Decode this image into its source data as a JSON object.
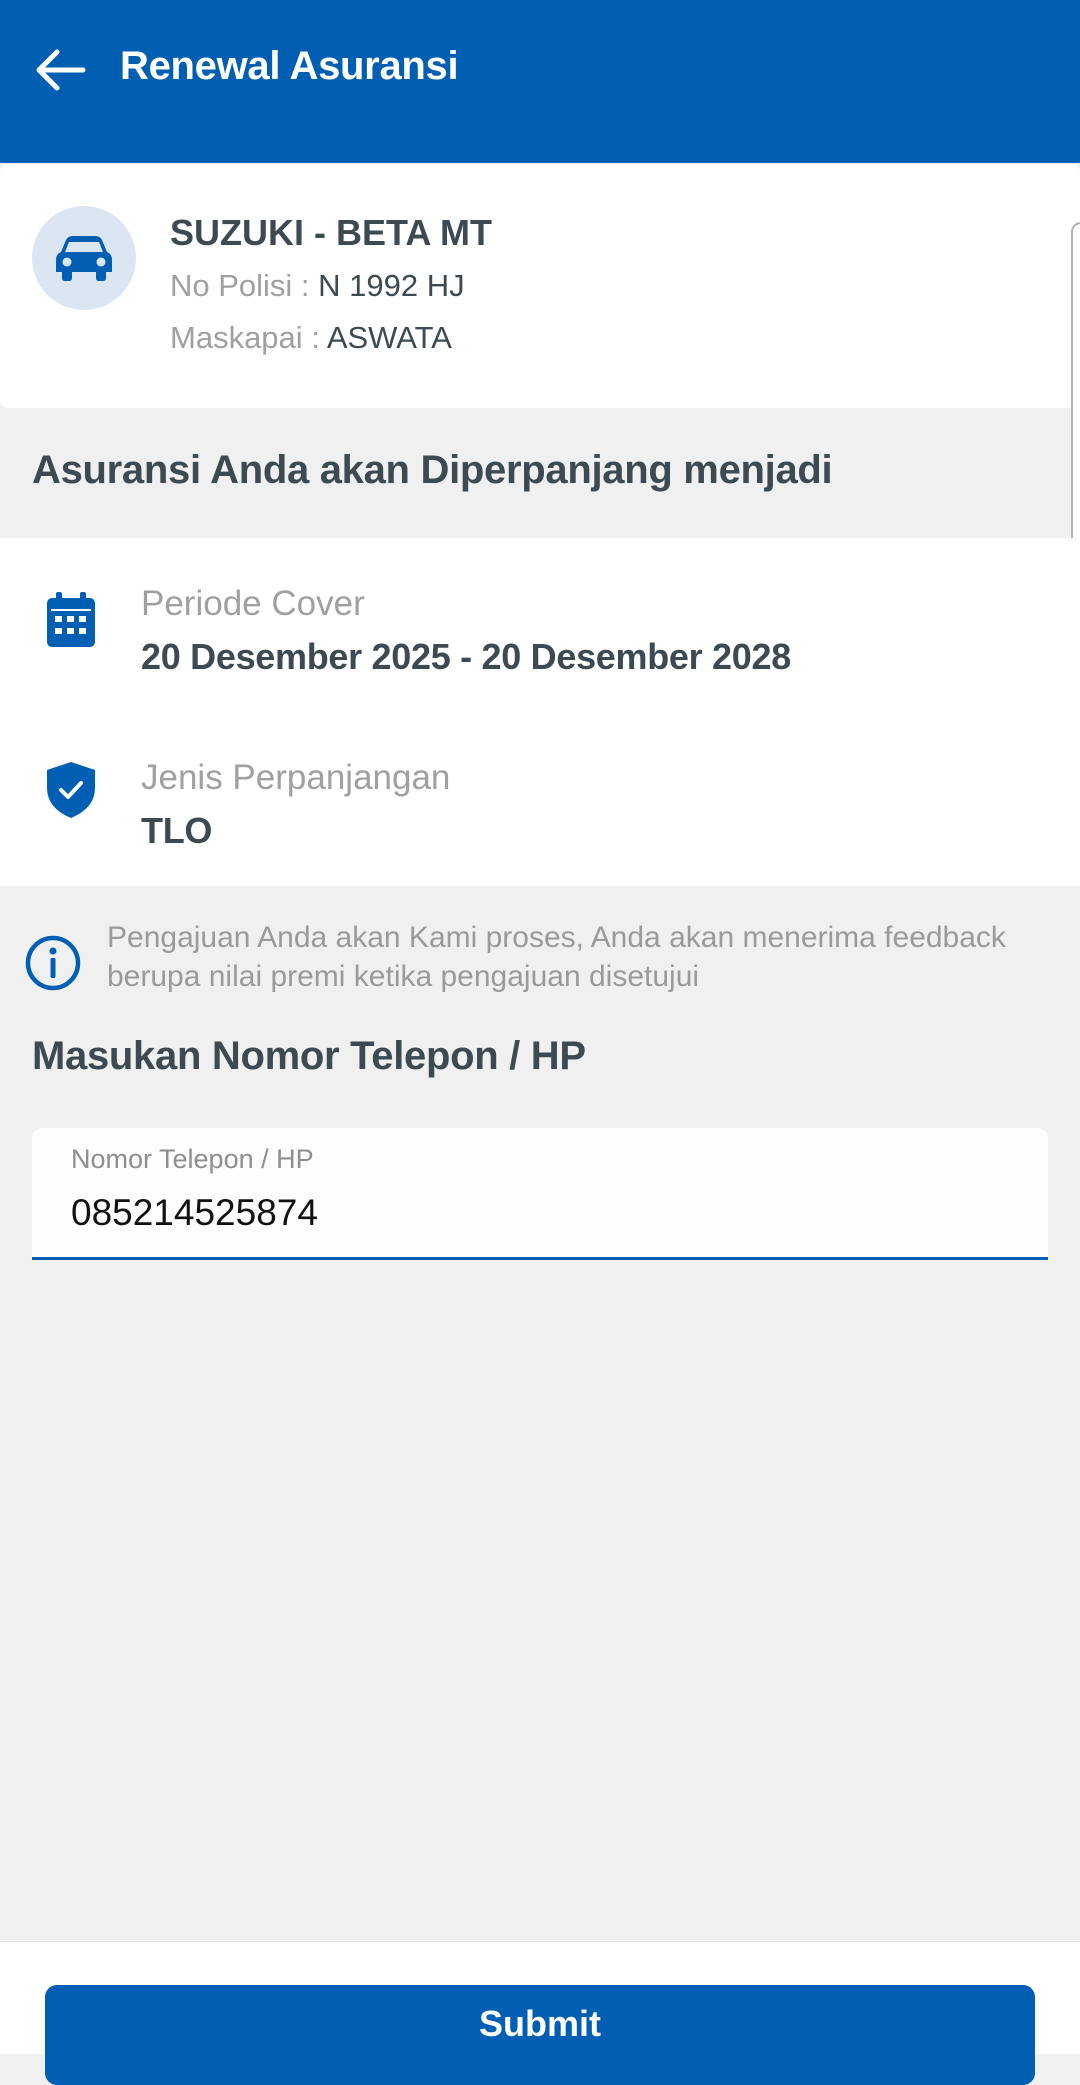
{
  "header": {
    "title": "Renewal Asuransi",
    "back_icon": "arrow-left-icon"
  },
  "vehicle": {
    "icon": "car-icon",
    "name": "SUZUKI - BETA MT",
    "police_label": "No Polisi : ",
    "police_value": "N 1992 HJ",
    "insurer_label": "Maskapai : ",
    "insurer_value": "ASWATA"
  },
  "renewal": {
    "heading": "Asuransi Anda akan Diperpanjang menjadi",
    "period_label": "Periode Cover",
    "period_value": "20 Desember 2025 - 20 Desember 2028",
    "period_icon": "calendar-icon",
    "type_label": "Jenis Perpanjangan",
    "type_value": "TLO",
    "type_icon": "shield-check-icon"
  },
  "notice": {
    "icon": "info-icon",
    "text": "Pengajuan Anda akan Kami proses, Anda akan menerima feedback berupa nilai premi ketika pengajuan disetujui"
  },
  "phone": {
    "heading": "Masukan Nomor Telepon / HP",
    "field_label": "Nomor Telepon / HP",
    "value": "085214525874"
  },
  "actions": {
    "submit_label": "Submit"
  },
  "colors": {
    "primary": "#005eb3",
    "avatar_bg": "#dbe6f2",
    "text_dark": "#3d4a52",
    "text_muted": "#a0a0a0",
    "background": "#f0f0f0"
  }
}
